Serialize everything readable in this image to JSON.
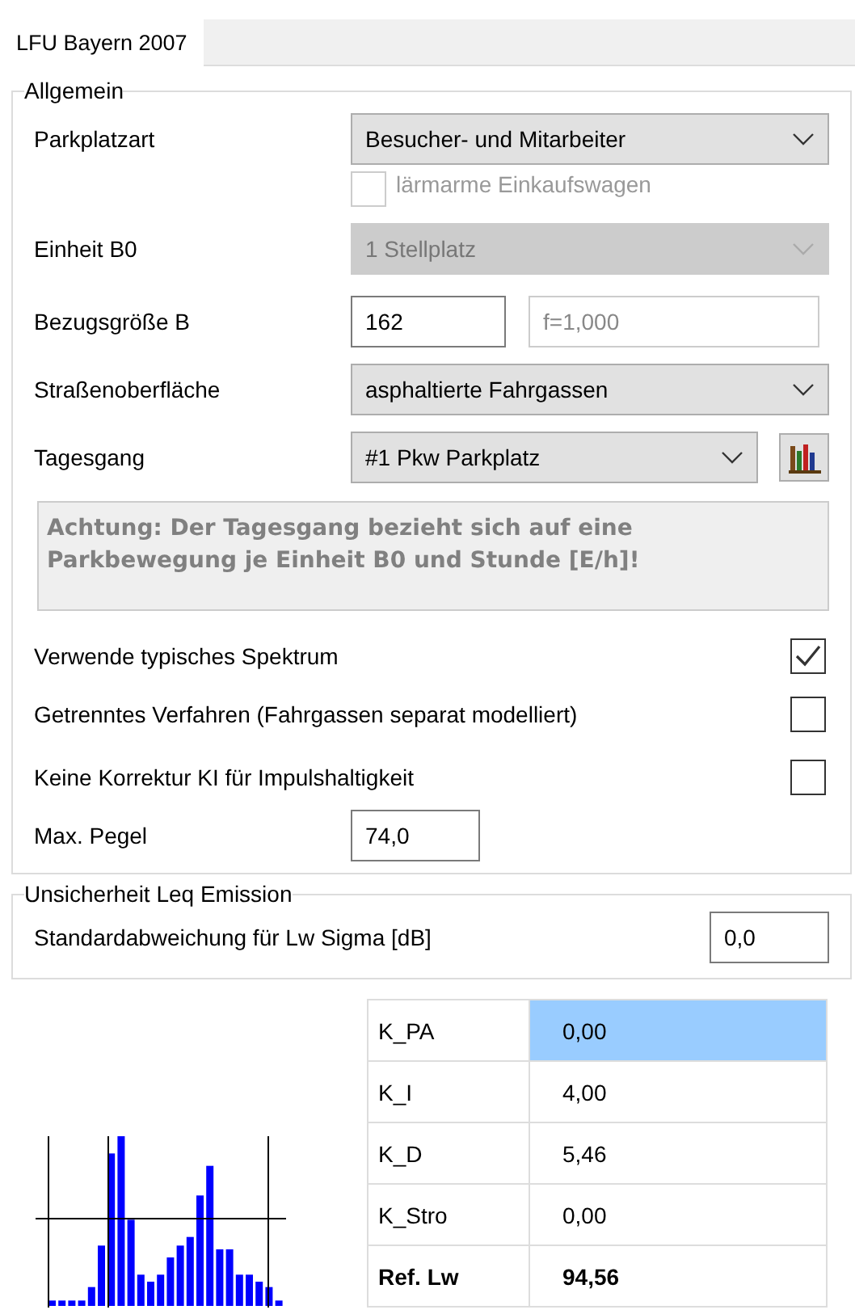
{
  "tabs": [
    {
      "label": "LFU Bayern 2007",
      "selected": true
    }
  ],
  "general": {
    "title": "Allgemein",
    "parking_type": {
      "label": "Parkplatzart",
      "value": "Besucher- und Mitarbeiter",
      "disabled": false
    },
    "quiet_carts": {
      "label": "lärmarme Einkaufswagen",
      "checked": false,
      "disabled": true
    },
    "unit": {
      "label": "Einheit B0",
      "value": "1 Stellplatz",
      "disabled": true
    },
    "reference": {
      "label": "Bezugsgröße B",
      "value": "162",
      "factor": "f=1,000"
    },
    "surface": {
      "label": "Straßenoberfläche",
      "value": "asphaltierte Fahrgassen",
      "disabled": false
    },
    "daily": {
      "label": "Tagesgang",
      "value": "#1 Pkw Parkplatz",
      "disabled": false
    },
    "note": "Achtung: Der Tagesgang bezieht sich auf eine Parkbewegung je Einheit B0 und Stunde [E/h]!",
    "options": [
      {
        "label": "Verwende typisches Spektrum",
        "checked": true
      },
      {
        "label": "Getrenntes Verfahren (Fahrgassen separat modelliert)",
        "checked": false
      },
      {
        "label": "Keine Korrektur KI für Impulshaltigkeit",
        "checked": false
      }
    ],
    "max_level": {
      "label": "Max. Pegel",
      "value": "74,0"
    }
  },
  "uncertainty": {
    "title": "Unsicherheit Leq Emission",
    "label": "Standardabweichung für Lw Sigma [dB]",
    "value": "0,0"
  },
  "results": [
    {
      "name": "K_PA",
      "value": "0,00",
      "selected": true,
      "bold": false
    },
    {
      "name": "K_I",
      "value": "4,00",
      "selected": false,
      "bold": false
    },
    {
      "name": "K_D",
      "value": "5,46",
      "selected": false,
      "bold": false
    },
    {
      "name": "K_Stro",
      "value": "0,00",
      "selected": false,
      "bold": false
    },
    {
      "name": "Ref. Lw",
      "value": "94,56",
      "selected": false,
      "bold": true
    }
  ]
}
